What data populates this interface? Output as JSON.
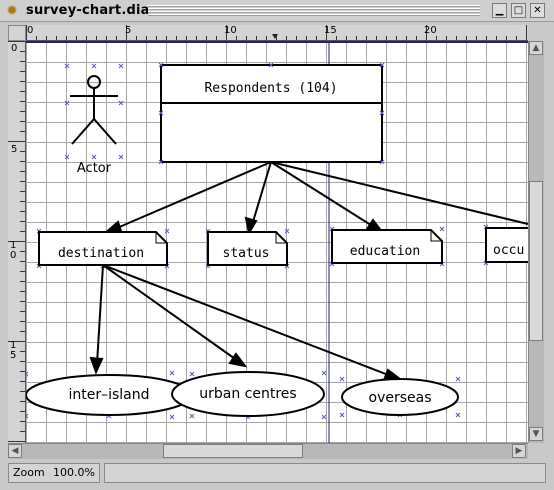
{
  "window": {
    "title": "survey-chart.dia",
    "buttons": [
      "minimize",
      "maximize",
      "close"
    ]
  },
  "rulers": {
    "horizontal_labels": [
      "0",
      "5",
      "10",
      "15",
      "20"
    ],
    "vertical_labels": [
      "0",
      "5",
      "10",
      "15"
    ]
  },
  "diagram": {
    "actor_label": "Actor",
    "class_box_title": "Respondents (104)",
    "notes": [
      {
        "label": "destination"
      },
      {
        "label": "status"
      },
      {
        "label": "education"
      },
      {
        "label": "occu"
      }
    ],
    "ellipses": [
      {
        "label": "inter–island"
      },
      {
        "label": "urban centres"
      },
      {
        "label": "overseas"
      }
    ]
  },
  "status": {
    "zoom_label": "Zoom",
    "zoom_value": "100.0%",
    "message": ""
  }
}
